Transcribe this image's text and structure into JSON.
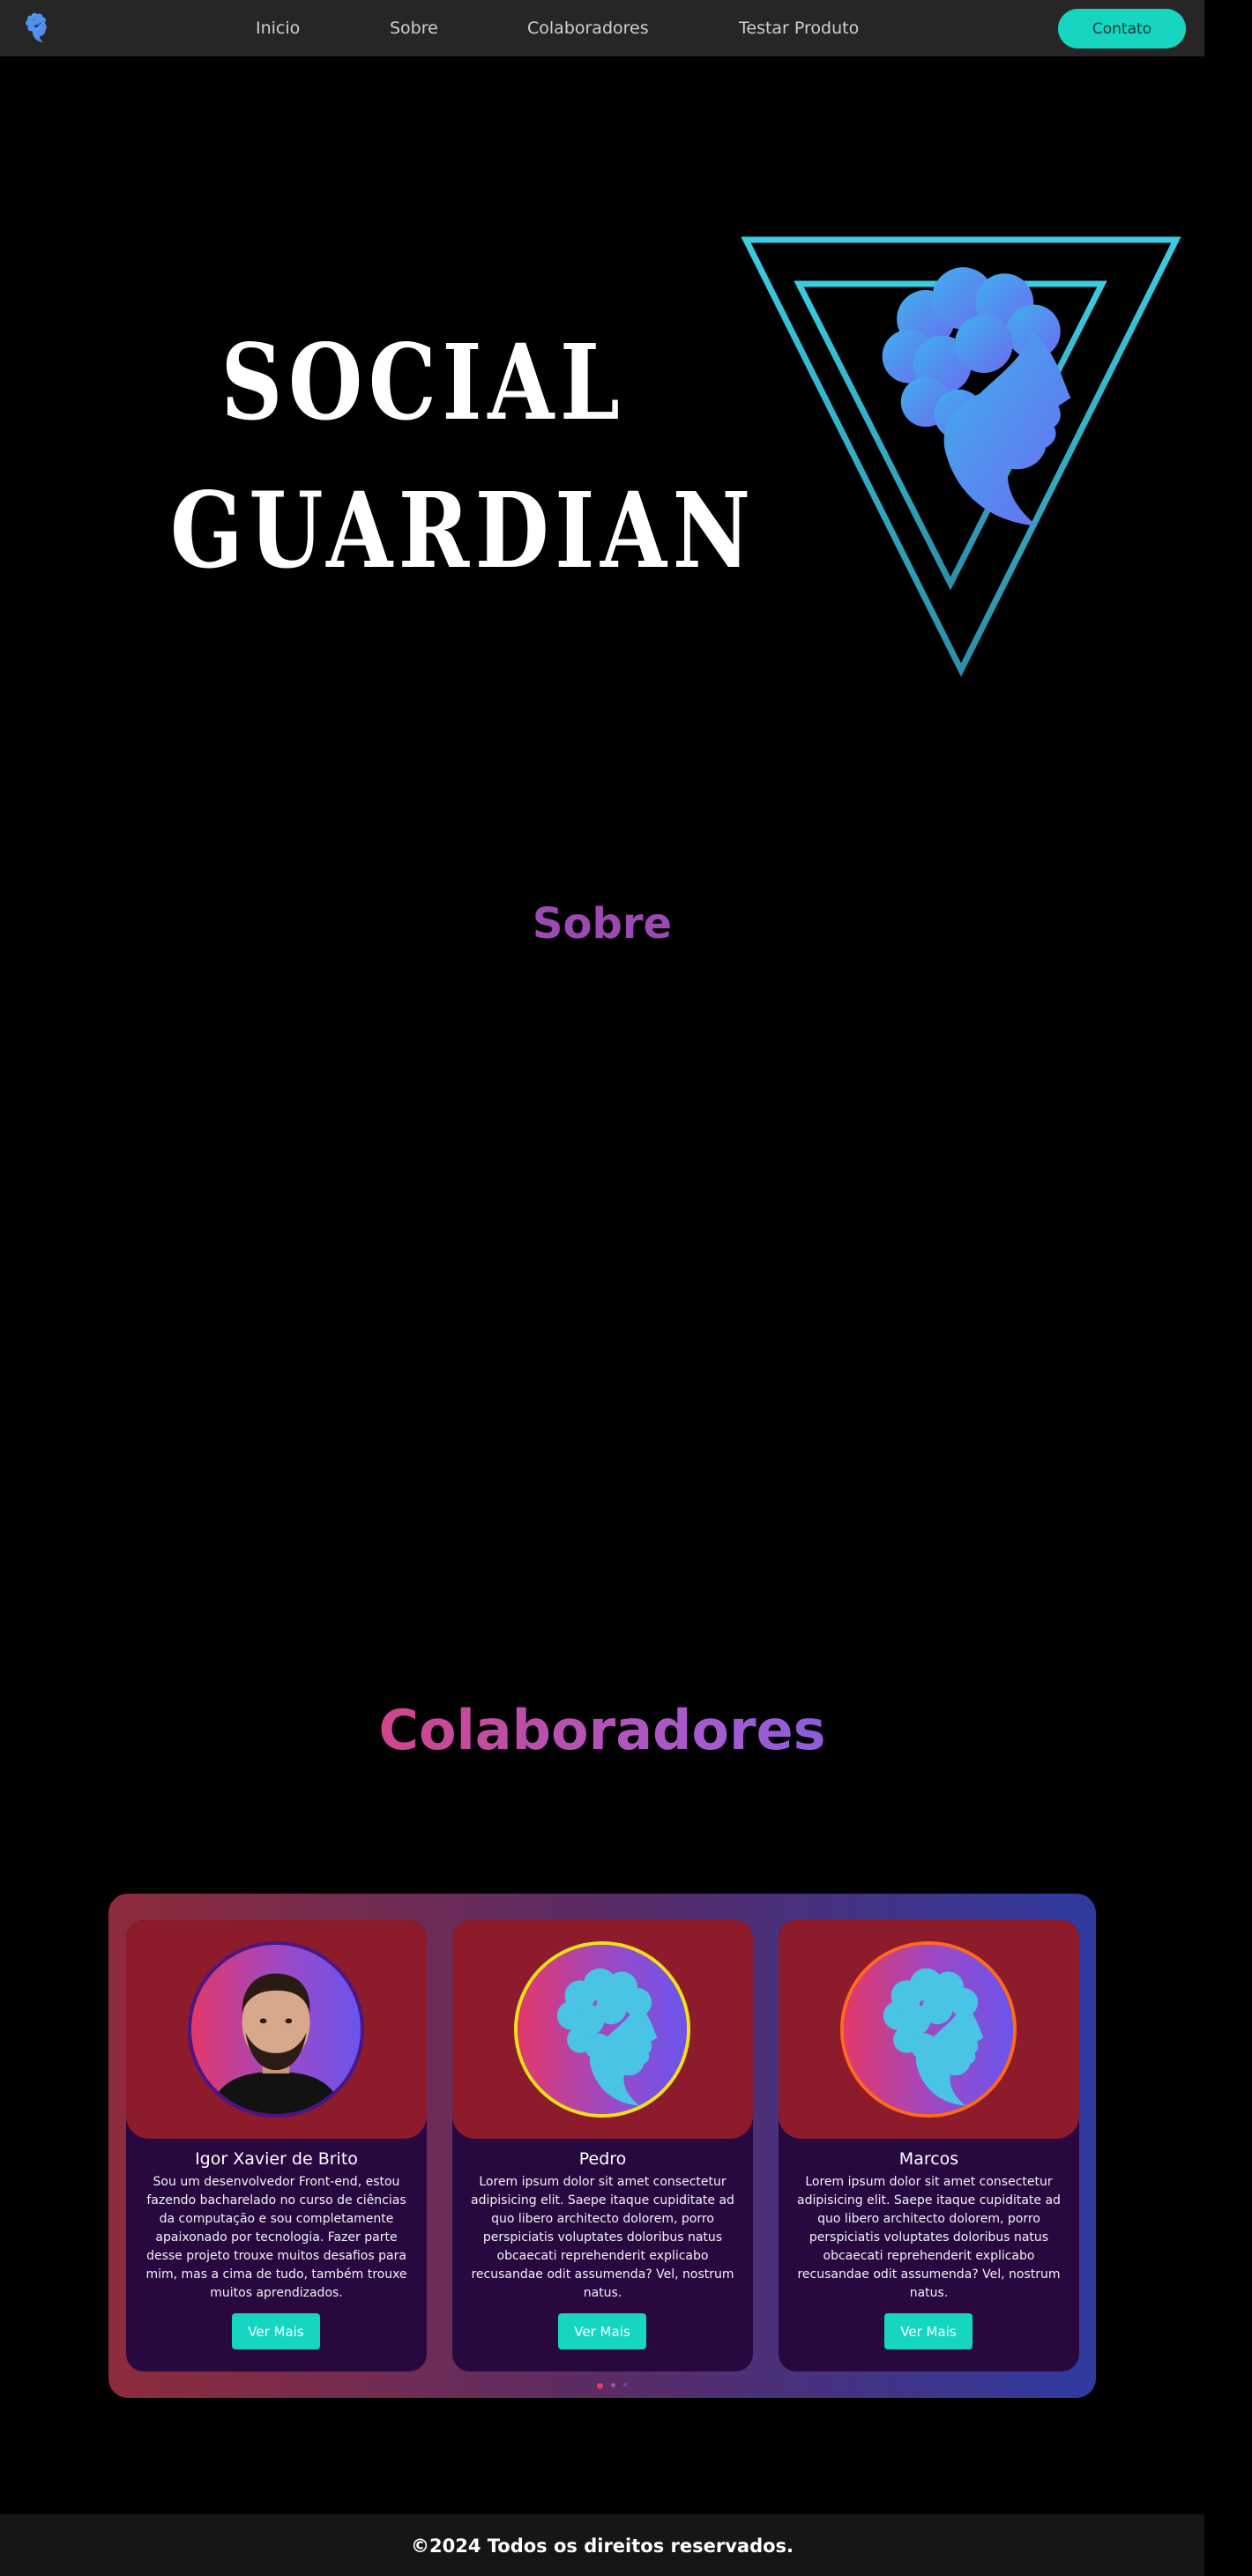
{
  "nav": {
    "logo_icon": "brain-head-icon",
    "links": [
      "Inicio",
      "Sobre",
      "Colaboradores",
      "Testar Produto"
    ],
    "contact_label": "Contato"
  },
  "hero": {
    "title_line1": "SOCIAL",
    "title_line2": "GUARDIAN",
    "logo_icon": "triangle-brain-head-icon"
  },
  "sobre": {
    "heading": "Sobre"
  },
  "colaboradores": {
    "heading": "Colaboradores",
    "cards": [
      {
        "name": "Igor Xavier de Brito",
        "description": "Sou um desenvolvedor Front-end, estou fazendo bacharelado no curso de ciências da computação e sou completamente apaixonado por tecnologia. Fazer parte desse projeto trouxe muitos desafios para mim, mas a cima de tudo, também trouxe muitos aprendizados.",
        "button": "Ver Mais",
        "avatar_icon": "person-photo"
      },
      {
        "name": "Pedro",
        "description": "Lorem ipsum dolor sit amet consectetur adipisicing elit. Saepe itaque cupiditate ad quo libero architecto dolorem, porro perspiciatis voluptates doloribus natus obcaecati reprehenderit explicabo recusandae odit assumenda? Vel, nostrum natus.",
        "button": "Ver Mais",
        "avatar_icon": "brain-head-icon"
      },
      {
        "name": "Marcos",
        "description": "Lorem ipsum dolor sit amet consectetur adipisicing elit. Saepe itaque cupiditate ad quo libero architecto dolorem, porro perspiciatis voluptates doloribus natus obcaecati reprehenderit explicabo recusandae odit assumenda? Vel, nostrum natus.",
        "button": "Ver Mais",
        "avatar_icon": "brain-head-icon"
      }
    ],
    "pagination": {
      "count": 3,
      "active": 1
    }
  },
  "footer": {
    "text": "©2024 Todos os direitos reservados."
  },
  "colors": {
    "accent": "#16d6c2",
    "navbar": "#262626",
    "sobre_heading": "#9b4ab1",
    "card_top": "#8d1b2c",
    "card_bottom": "#27083f"
  }
}
